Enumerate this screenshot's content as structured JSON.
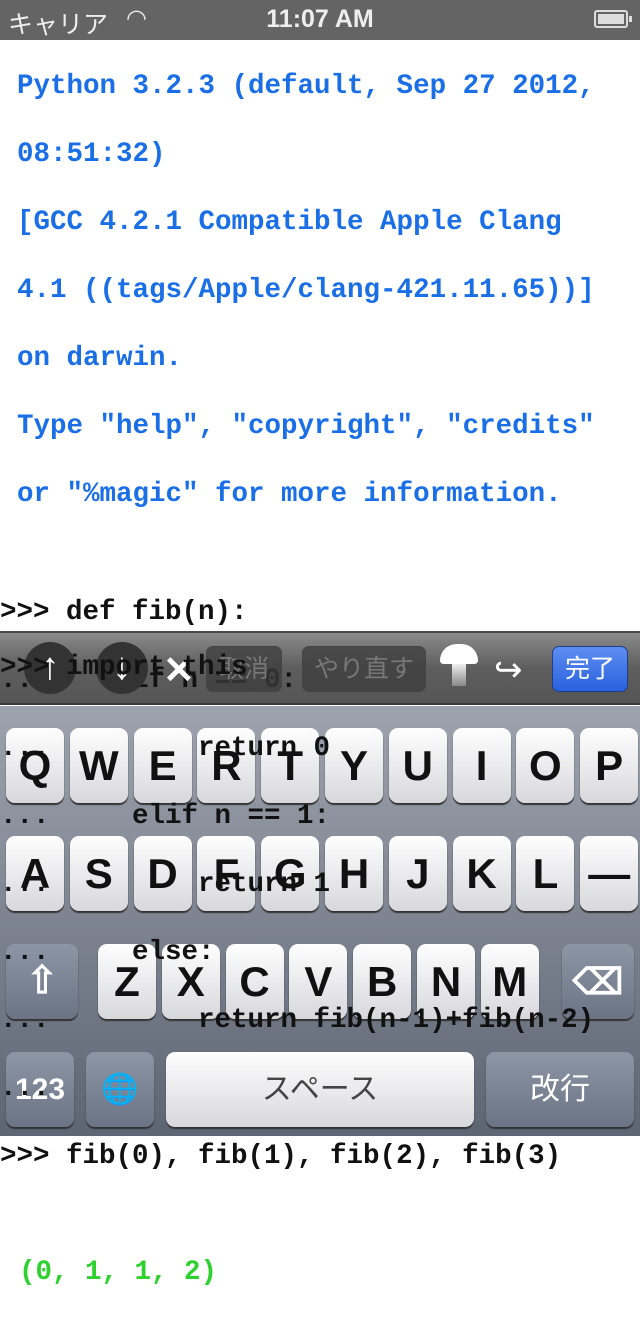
{
  "status": {
    "carrier": "キャリア",
    "time": "11:07 AM",
    "battery_level": 1.0
  },
  "console": {
    "banner": [
      "Python 3.2.3 (default, Sep 27 2012,",
      "08:51:32)",
      "[GCC 4.2.1 Compatible Apple Clang",
      "4.1 ((tags/Apple/clang-421.11.65))]",
      "on darwin.",
      "Type \"help\", \"copyright\", \"credits\"",
      "or \"%magic\" for more information."
    ],
    "code": [
      ">>> def fib(n):",
      "...     if n == 0:",
      "...         return 0",
      "...     elif n == 1:",
      "...         return 1",
      "...     else:",
      "...         return fib(n-1)+fib(n-2)",
      "...",
      ">>> fib(0), fib(1), fib(2), fib(3)"
    ],
    "output": "(0, 1, 1, 2)",
    "current_input": ">>> import this"
  },
  "toolbar": {
    "up": "↑",
    "down": "↓",
    "clear": "✕",
    "undo": "取消",
    "redo": "やり直す",
    "done": "完了"
  },
  "keyboard": {
    "row1": [
      "Q",
      "W",
      "E",
      "R",
      "T",
      "Y",
      "U",
      "I",
      "O",
      "P"
    ],
    "row2": [
      "A",
      "S",
      "D",
      "F",
      "G",
      "H",
      "J",
      "K",
      "L",
      "—"
    ],
    "row3": [
      "Z",
      "X",
      "C",
      "V",
      "B",
      "N",
      "M"
    ],
    "shift": "⇧",
    "backspace": "⌫",
    "numbers": "123",
    "globe": "🌐",
    "space": "スペース",
    "return": "改行"
  },
  "colors": {
    "banner": "#1a6fe6",
    "output": "#2fd12f",
    "done_button": "#2a62de"
  }
}
